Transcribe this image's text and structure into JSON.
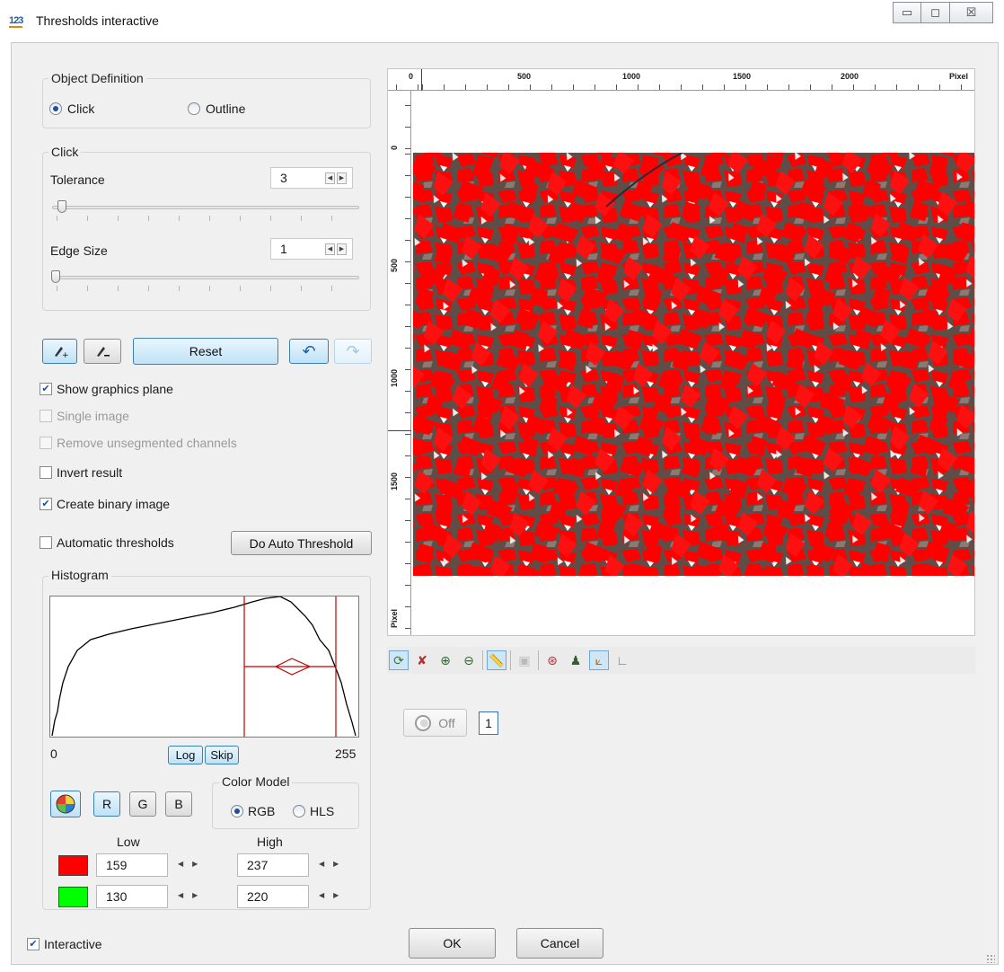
{
  "window": {
    "title": "Thresholds interactive",
    "controls": {
      "minimize": "▭",
      "maximize": "◻",
      "close": "☒"
    }
  },
  "object_definition": {
    "title": "Object Definition",
    "options": [
      {
        "label": "Click",
        "selected": true
      },
      {
        "label": "Outline",
        "selected": false
      }
    ]
  },
  "click_group": {
    "title": "Click",
    "tolerance": {
      "label": "Tolerance",
      "value": "3"
    },
    "edge_size": {
      "label": "Edge Size",
      "value": "1"
    }
  },
  "tools": {
    "reset_label": "Reset"
  },
  "options": {
    "show_graphics_plane": {
      "label": "Show graphics plane",
      "checked": true,
      "enabled": true
    },
    "single_image": {
      "label": "Single image",
      "checked": false,
      "enabled": false
    },
    "remove_unsegmented": {
      "label": "Remove unsegmented channels",
      "checked": false,
      "enabled": false
    },
    "invert_result": {
      "label": "Invert result",
      "checked": false,
      "enabled": true
    },
    "create_binary": {
      "label": "Create binary image",
      "checked": true,
      "enabled": true
    },
    "automatic_thresholds": {
      "label": "Automatic thresholds",
      "checked": false,
      "enabled": true
    },
    "do_auto_threshold": "Do Auto Threshold"
  },
  "histogram": {
    "title": "Histogram",
    "min_label": "0",
    "max_label": "255",
    "log_label": "Log",
    "skip_label": "Skip",
    "low_marker": 159,
    "high_marker": 237
  },
  "channels": {
    "r_label": "R",
    "g_label": "G",
    "b_label": "B",
    "color_model": {
      "title": "Color Model",
      "options": [
        {
          "label": "RGB",
          "selected": true
        },
        {
          "label": "HLS",
          "selected": false
        }
      ]
    }
  },
  "thresholds": {
    "low_header": "Low",
    "high_header": "High",
    "rows": [
      {
        "color": "#ff0000",
        "low": "159",
        "high": "237"
      },
      {
        "color": "#00ff00",
        "low": "130",
        "high": "220"
      }
    ]
  },
  "viewer": {
    "x_ruler": [
      "0",
      "500",
      "1000",
      "1500",
      "2000",
      "Pixel"
    ],
    "y_ruler": [
      "0",
      "500",
      "1000",
      "1500",
      "Pixel"
    ],
    "overlay_color": "#ff0000"
  },
  "playback": {
    "toggle_label": "Off",
    "frame": "1"
  },
  "footer": {
    "interactive_label": "Interactive",
    "interactive_checked": true,
    "ok_label": "OK",
    "cancel_label": "Cancel"
  }
}
